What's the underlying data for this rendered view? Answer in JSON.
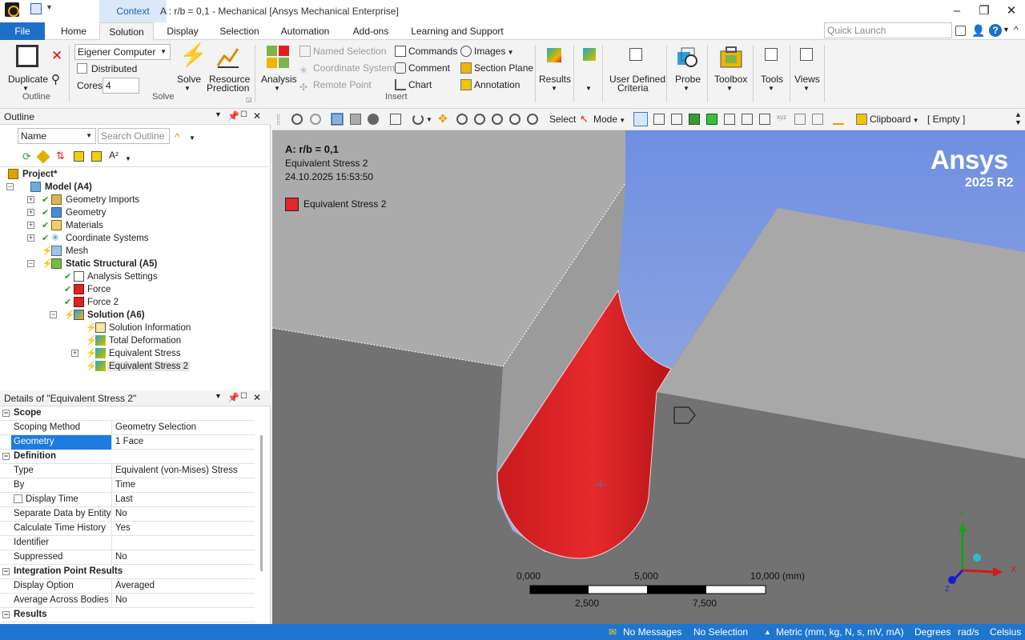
{
  "window": {
    "title": "A : r/b = 0,1 - Mechanical [Ansys Mechanical Enterprise]",
    "context_tab": "Context"
  },
  "tabs": [
    "File",
    "Home",
    "Solution",
    "Display",
    "Selection",
    "Automation",
    "Add-ons",
    "Learning and Support"
  ],
  "quick_launch_placeholder": "Quick Launch",
  "ribbon": {
    "outline": {
      "duplicate": "Duplicate",
      "group": "Outline"
    },
    "solve": {
      "computer": "Eigener Computer",
      "distributed": "Distributed",
      "cores_label": "Cores",
      "cores_value": "4",
      "solve": "Solve",
      "resource_prediction_1": "Resource",
      "resource_prediction_2": "Prediction",
      "group": "Solve"
    },
    "insert": {
      "analysis": "Analysis",
      "named_selection": "Named Selection",
      "coordinate_system": "Coordinate System",
      "remote_point": "Remote Point",
      "commands": "Commands",
      "comment": "Comment",
      "chart": "Chart",
      "images": "Images",
      "section_plane": "Section Plane",
      "annotation": "Annotation",
      "group": "Insert"
    },
    "results": "Results",
    "udc_1": "User Defined",
    "udc_2": "Criteria",
    "probe": "Probe",
    "toolbox": "Toolbox",
    "tools": "Tools",
    "views": "Views"
  },
  "outline": {
    "header": "Outline",
    "name_combo": "Name",
    "search_placeholder": "Search Outline",
    "tree": [
      {
        "label": "Project*",
        "bold": true
      },
      {
        "label": "Model (A4)",
        "bold": true
      },
      {
        "label": "Geometry Imports"
      },
      {
        "label": "Geometry"
      },
      {
        "label": "Materials"
      },
      {
        "label": "Coordinate Systems"
      },
      {
        "label": "Mesh"
      },
      {
        "label": "Static Structural (A5)",
        "bold": true
      },
      {
        "label": "Analysis Settings"
      },
      {
        "label": "Force"
      },
      {
        "label": "Force 2"
      },
      {
        "label": "Solution (A6)",
        "bold": true
      },
      {
        "label": "Solution Information"
      },
      {
        "label": "Total Deformation"
      },
      {
        "label": "Equivalent Stress"
      },
      {
        "label": "Equivalent Stress 2",
        "selected": true
      }
    ]
  },
  "details": {
    "header": "Details of \"Equivalent Stress 2\"",
    "rows": [
      {
        "section": "Scope"
      },
      {
        "key": "Scoping Method",
        "value": "Geometry Selection"
      },
      {
        "key": "Geometry",
        "value": "1 Face",
        "highlight": true
      },
      {
        "section": "Definition"
      },
      {
        "key": "Type",
        "value": "Equivalent (von-Mises) Stress"
      },
      {
        "key": "By",
        "value": "Time"
      },
      {
        "key": "Display Time",
        "value": "Last",
        "checkbox": true
      },
      {
        "key": "Separate Data by Entity",
        "value": "No"
      },
      {
        "key": "Calculate Time History",
        "value": "Yes"
      },
      {
        "key": "Identifier",
        "value": ""
      },
      {
        "key": "Suppressed",
        "value": "No"
      },
      {
        "section": "Integration Point Results"
      },
      {
        "key": "Display Option",
        "value": "Averaged"
      },
      {
        "key": "Average Across Bodies",
        "value": "No"
      },
      {
        "section": "Results"
      }
    ]
  },
  "view_toolbar": {
    "select": "Select",
    "mode": "Mode",
    "clipboard": "Clipboard",
    "empty": "[ Empty ]"
  },
  "viewport": {
    "title": "A: r/b = 0,1",
    "subtitle": "Equivalent Stress 2",
    "timestamp": "24.10.2025 15:53:50",
    "legend_label": "Equivalent Stress 2",
    "legend_color": "#e2262a",
    "brand": "Ansys",
    "version": "2025 R2",
    "scale": {
      "top": [
        "0,000",
        "5,000",
        "10,000 (mm)"
      ],
      "bottom": [
        "2,500",
        "7,500"
      ]
    },
    "triad": {
      "x": "X",
      "y": "Y",
      "z": "Z"
    }
  },
  "status": {
    "messages": "No Messages",
    "selection": "No Selection",
    "units": "Metric (mm, kg, N, s, mV, mA)",
    "angle": "Degrees",
    "rot": "rad/s",
    "temp": "Celsius"
  }
}
